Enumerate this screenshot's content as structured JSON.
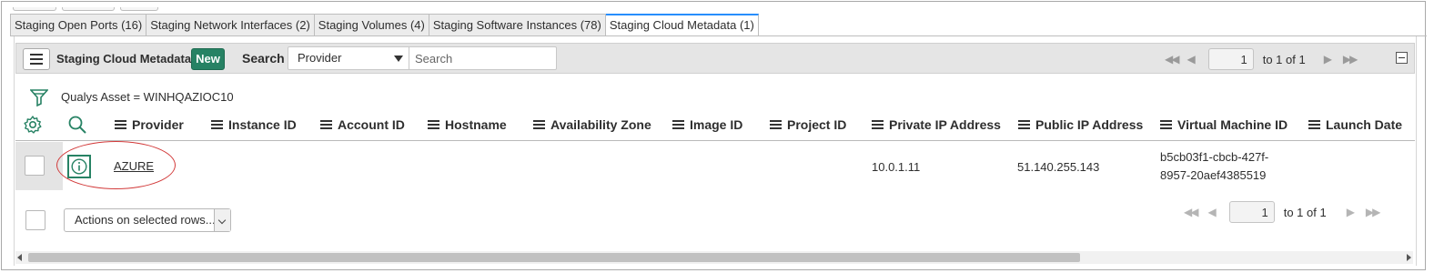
{
  "tabs": [
    {
      "label": "Staging Open Ports (16)",
      "active": false
    },
    {
      "label": "Staging Network Interfaces (2)",
      "active": false
    },
    {
      "label": "Staging Volumes (4)",
      "active": false
    },
    {
      "label": "Staging Software Instances (78)",
      "active": false
    },
    {
      "label": "Staging Cloud Metadata (1)",
      "active": true
    }
  ],
  "header": {
    "list_title": "Staging Cloud Metadata",
    "new_label": "New",
    "search_label": "Search",
    "search_field": "Provider",
    "search_placeholder": "Search"
  },
  "pager_top": {
    "page": "1",
    "summary": "to 1 of 1"
  },
  "filter": {
    "text": "Qualys Asset = WINHQAZIOC10"
  },
  "columns": [
    "Provider",
    "Instance ID",
    "Account ID",
    "Hostname",
    "Availability Zone",
    "Image ID",
    "Project ID",
    "Private IP Address",
    "Public IP Address",
    "Virtual Machine ID",
    "Launch Date"
  ],
  "row": {
    "provider": "AZURE",
    "private_ip": "10.0.1.11",
    "public_ip": "51.140.255.143",
    "vm_id_line1": "b5cb03f1-cbcb-427f-",
    "vm_id_line2": "8957-20aef4385519"
  },
  "footer": {
    "actions_label": "Actions on selected rows..."
  },
  "pager_bottom": {
    "page": "1",
    "summary": "to 1 of 1"
  },
  "colors": {
    "accent_green": "#278264",
    "active_tab_border": "#278efc",
    "highlight_red": "#d23a3a"
  }
}
